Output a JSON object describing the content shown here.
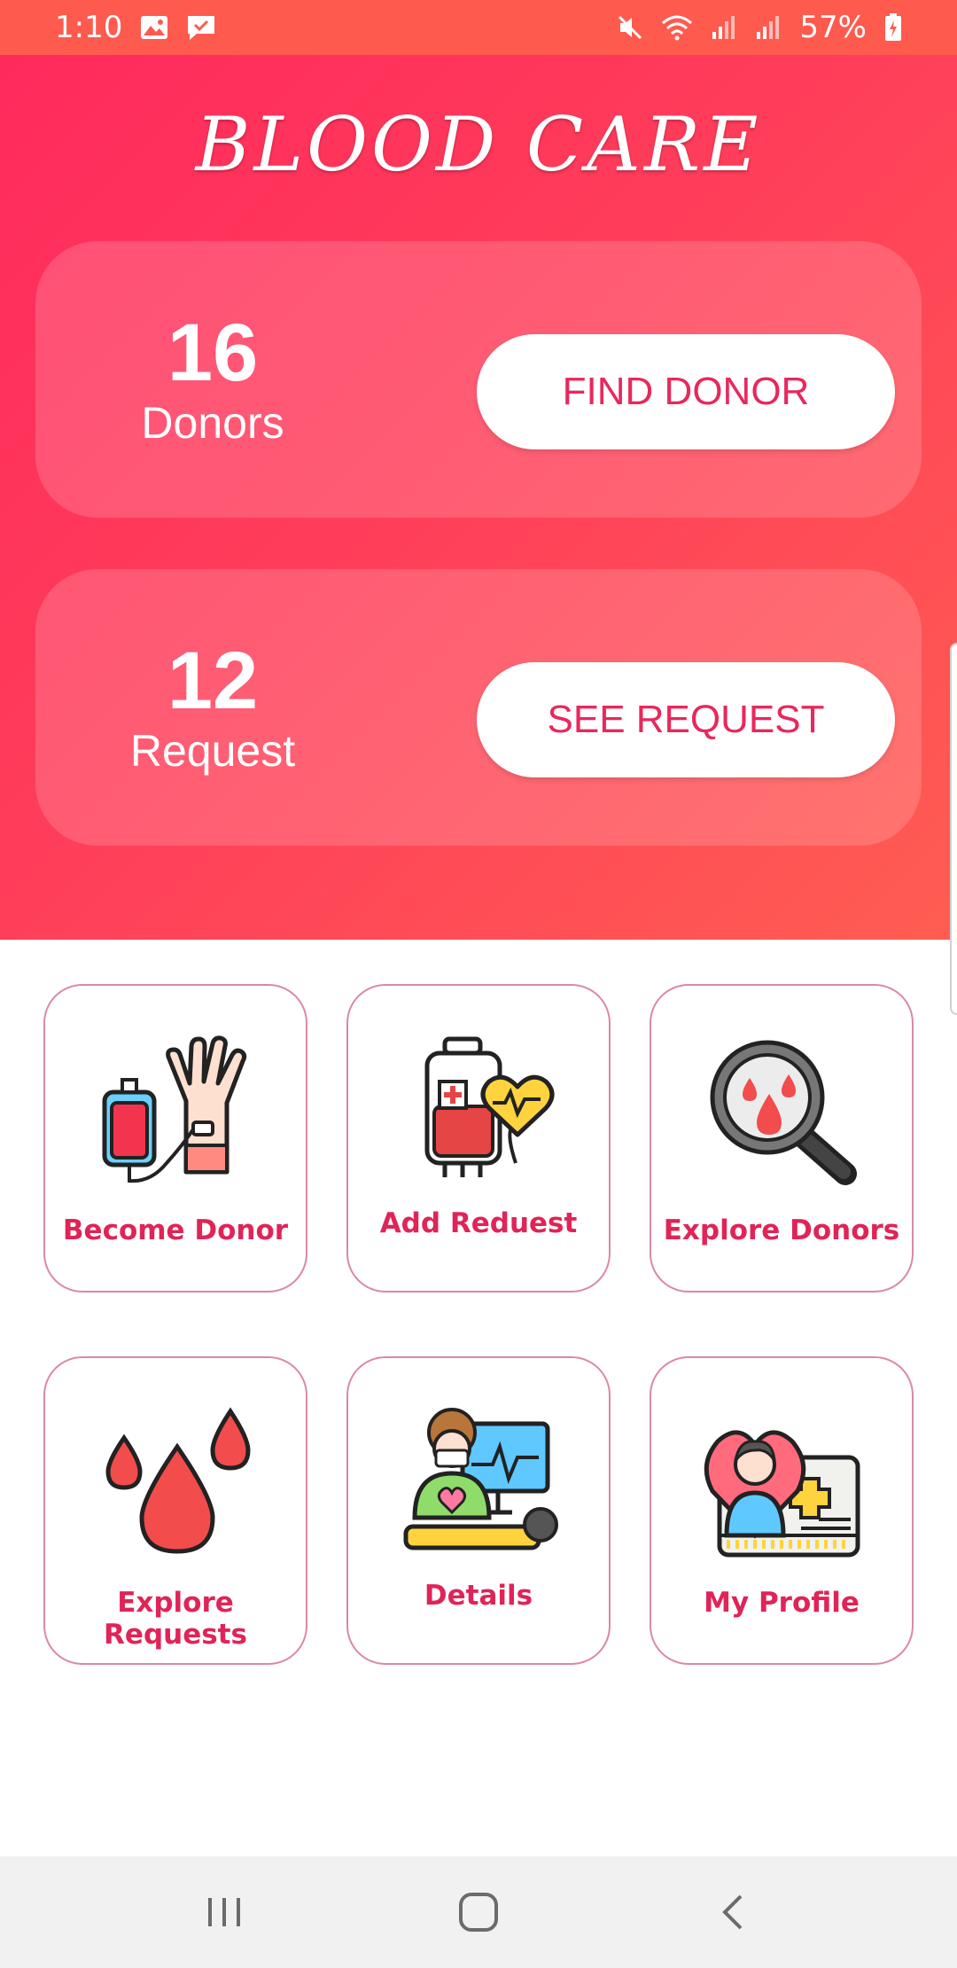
{
  "status_bar": {
    "time": "1:10",
    "battery": "57%"
  },
  "app": {
    "title": "BLOOD CARE"
  },
  "stats": [
    {
      "value": "16",
      "label": "Donors",
      "button": "FIND DONOR"
    },
    {
      "value": "12",
      "label": "Request",
      "button": "SEE REQUEST"
    }
  ],
  "tiles": [
    {
      "label": "Become Donor",
      "icon": "blood-bag-hand-icon"
    },
    {
      "label": "Add Reduest",
      "icon": "blood-bag-heart-icon"
    },
    {
      "label": "Explore Donors",
      "icon": "magnifier-blood-icon"
    },
    {
      "label": "Explore Requests",
      "icon": "blood-drops-icon"
    },
    {
      "label": "Details",
      "icon": "doctor-monitor-icon"
    },
    {
      "label": "My Profile",
      "icon": "profile-card-icon"
    }
  ],
  "colors": {
    "accent": "#e8285c",
    "header_start": "#ff2a5c",
    "header_end": "#ff5d52",
    "status_bar": "#ff5a4e"
  }
}
